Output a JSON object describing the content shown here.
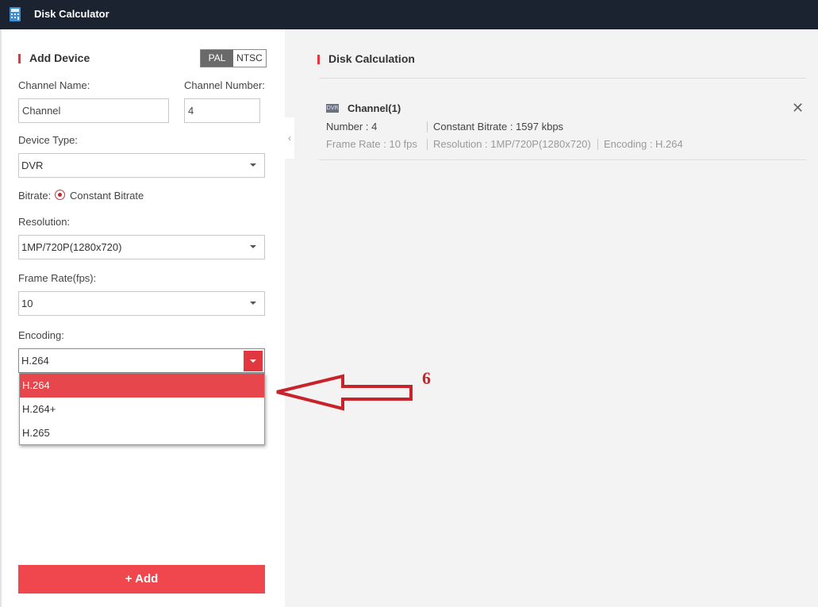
{
  "window": {
    "title": "Disk Calculator"
  },
  "left_panel": {
    "section_title": "Add Device",
    "video_standard": {
      "options": [
        "PAL",
        "NTSC"
      ],
      "selected": "PAL"
    },
    "channel_name": {
      "label": "Channel Name:",
      "value": "Channel"
    },
    "channel_number": {
      "label": "Channel Number:",
      "value": "4"
    },
    "device_type": {
      "label": "Device Type:",
      "value": "DVR"
    },
    "bitrate": {
      "label": "Bitrate:",
      "option": "Constant Bitrate"
    },
    "resolution": {
      "label": "Resolution:",
      "value": "1MP/720P(1280x720)"
    },
    "frame_rate": {
      "label": "Frame Rate(fps):",
      "value": "10"
    },
    "encoding": {
      "label": "Encoding:",
      "value": "H.264",
      "options": [
        "H.264",
        "H.264+",
        "H.265"
      ],
      "highlighted": "H.264"
    },
    "add_button": "+ Add"
  },
  "right_panel": {
    "section_title": "Disk Calculation",
    "channel": {
      "icon_text": "DVR",
      "title": "Channel(1)",
      "number": "Number : 4",
      "bitrate": "Constant Bitrate : 1597 kbps",
      "frame_rate": "Frame Rate : 10 fps",
      "resolution": "Resolution : 1MP/720P(1280x720)",
      "encoding": "Encoding : H.264"
    }
  },
  "annotation": {
    "number": "6"
  },
  "colors": {
    "accent": "#e0383e",
    "titlebar": "#1c2330",
    "annotation": "#c8222a"
  }
}
